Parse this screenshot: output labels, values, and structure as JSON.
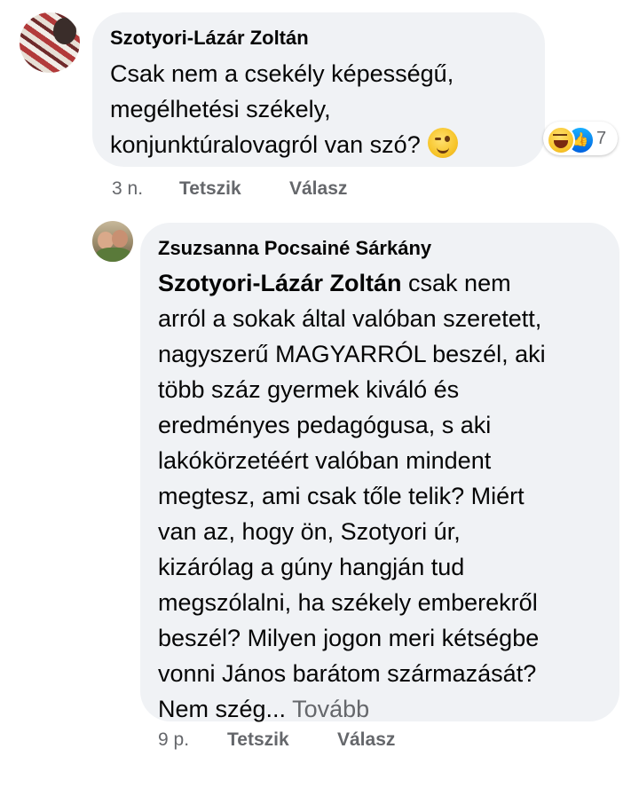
{
  "comments": [
    {
      "author": "Szotyori-Lázár Zoltán",
      "lines": [
        "Csak nem a csekély képességű,",
        "megélhetési székely,",
        "konjunktúralovagról van szó?"
      ],
      "emoji": "wink-emoji",
      "reactions": {
        "icons": [
          "haha-icon",
          "like-icon"
        ],
        "count": "7"
      },
      "time": "3 n.",
      "like_label": "Tetszik",
      "reply_label": "Válasz"
    },
    {
      "author": "Zsuzsanna Pocsainé Sárkány",
      "mention": "Szotyori-Lázár Zoltán",
      "first_line_rest": " csak nem",
      "lines": [
        "arról a sokak által valóban szeretett,",
        "nagyszerű MAGYARRÓL beszél,  aki",
        "több száz gyermek kiváló és",
        "eredményes pedagógusa, s aki",
        "lakókörzetéért valóban mindent",
        "megtesz, ami csak tőle telik? Miért",
        "van az,  hogy ön,  Szotyori úr,",
        "kizárólag a gúny hangján tud",
        "megszólalni, ha székely emberekről",
        "beszél? Milyen jogon meri kétségbe",
        "vonni János barátom származását?"
      ],
      "last_line": "Nem szég...",
      "more_label": "Tovább",
      "time": "9 p.",
      "like_label": "Tetszik",
      "reply_label": "Válasz"
    }
  ]
}
